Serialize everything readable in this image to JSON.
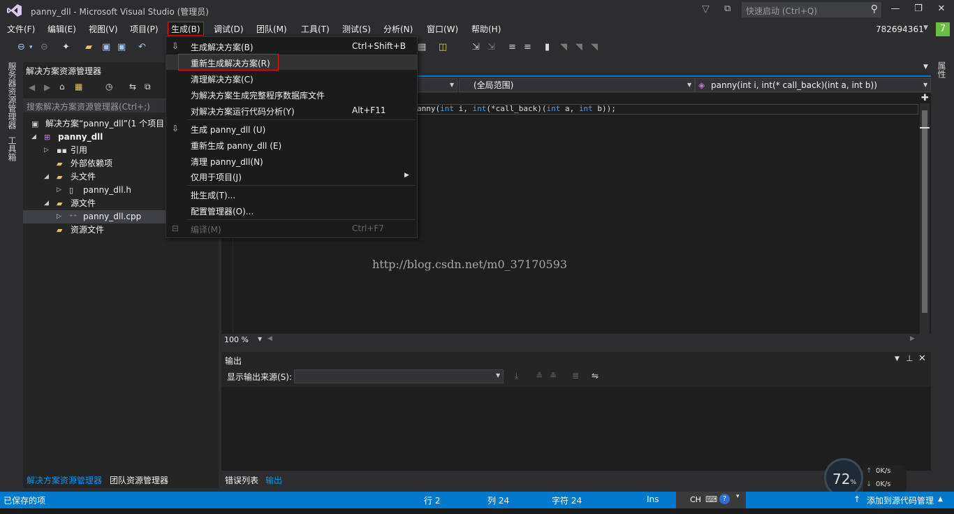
{
  "window": {
    "title": "panny_dll - Microsoft Visual Studio (管理员)",
    "quick_launch_placeholder": "快速启动 (Ctrl+Q)",
    "user": "782694361",
    "notification_count": "7"
  },
  "menu": {
    "file": "文件(F)",
    "edit": "编辑(E)",
    "view": "视图(V)",
    "project": "项目(P)",
    "build": "生成(B)",
    "debug": "调试(D)",
    "team": "团队(M)",
    "tools": "工具(T)",
    "test": "测试(S)",
    "analyze": "分析(N)",
    "window": "窗口(W)",
    "help": "帮助(H)"
  },
  "build_menu": {
    "items": [
      {
        "label": "生成解决方案(B)",
        "shortcut": "Ctrl+Shift+B"
      },
      {
        "label": "重新生成解决方案(R)",
        "shortcut": ""
      },
      {
        "label": "清理解决方案(C)",
        "shortcut": ""
      },
      {
        "label": "为解决方案生成完整程序数据库文件",
        "shortcut": ""
      },
      {
        "label": "对解决方案运行代码分析(Y)",
        "shortcut": "Alt+F11"
      },
      {
        "label": "生成 panny_dll (U)",
        "shortcut": ""
      },
      {
        "label": "重新生成 panny_dll (E)",
        "shortcut": ""
      },
      {
        "label": "清理 panny_dll(N)",
        "shortcut": ""
      },
      {
        "label": "仅用于项目(J)",
        "shortcut": ""
      },
      {
        "label": "批生成(T)...",
        "shortcut": ""
      },
      {
        "label": "配置管理器(O)...",
        "shortcut": ""
      },
      {
        "label": "编译(M)",
        "shortcut": "Ctrl+F7"
      }
    ]
  },
  "left_strip": {
    "server_explorer": "服务器资源管理器",
    "toolbox": "工具箱"
  },
  "solution_explorer": {
    "title": "解决方案资源管理器",
    "search_placeholder": "搜索解决方案资源管理器(Ctrl+;)",
    "tree": {
      "solution": "解决方案“panny_dll”(1 个项目",
      "project": "panny_dll",
      "references": "引用",
      "external_deps": "外部依赖项",
      "headers": "头文件",
      "header_file": "panny_dll.h",
      "sources": "源文件",
      "source_file": "panny_dll.cpp",
      "resources": "资源文件"
    },
    "bottom_tabs": [
      "解决方案资源管理器",
      "团队资源管理器"
    ]
  },
  "editor": {
    "scope": "(全局范围)",
    "member": "panny(int i, int(* call_back)(int a, int b))",
    "code_prefix": "anny(",
    "code_kw_int": "int",
    "code_i": " i, ",
    "code_cb": "(*call_back)(",
    "code_a": " a, ",
    "code_b": " b));",
    "watermark": "http://blog.csdn.net/m0_37170593",
    "zoom": "100 %"
  },
  "output": {
    "title": "输出",
    "source_label": "显示输出来源(S):",
    "tabs": [
      "错误列表",
      "输出"
    ]
  },
  "statusbar": {
    "status": "已保存的项",
    "line": "行 2",
    "col": "列 24",
    "char": "字符 24",
    "mode": "Ins",
    "ime": "CH",
    "source_control": "添加到源代码管理"
  },
  "network_widget": {
    "percent": "72",
    "percent_unit": "%",
    "up": "0K/s",
    "down": "0K/s"
  },
  "right_strip": {
    "label": "属性"
  }
}
